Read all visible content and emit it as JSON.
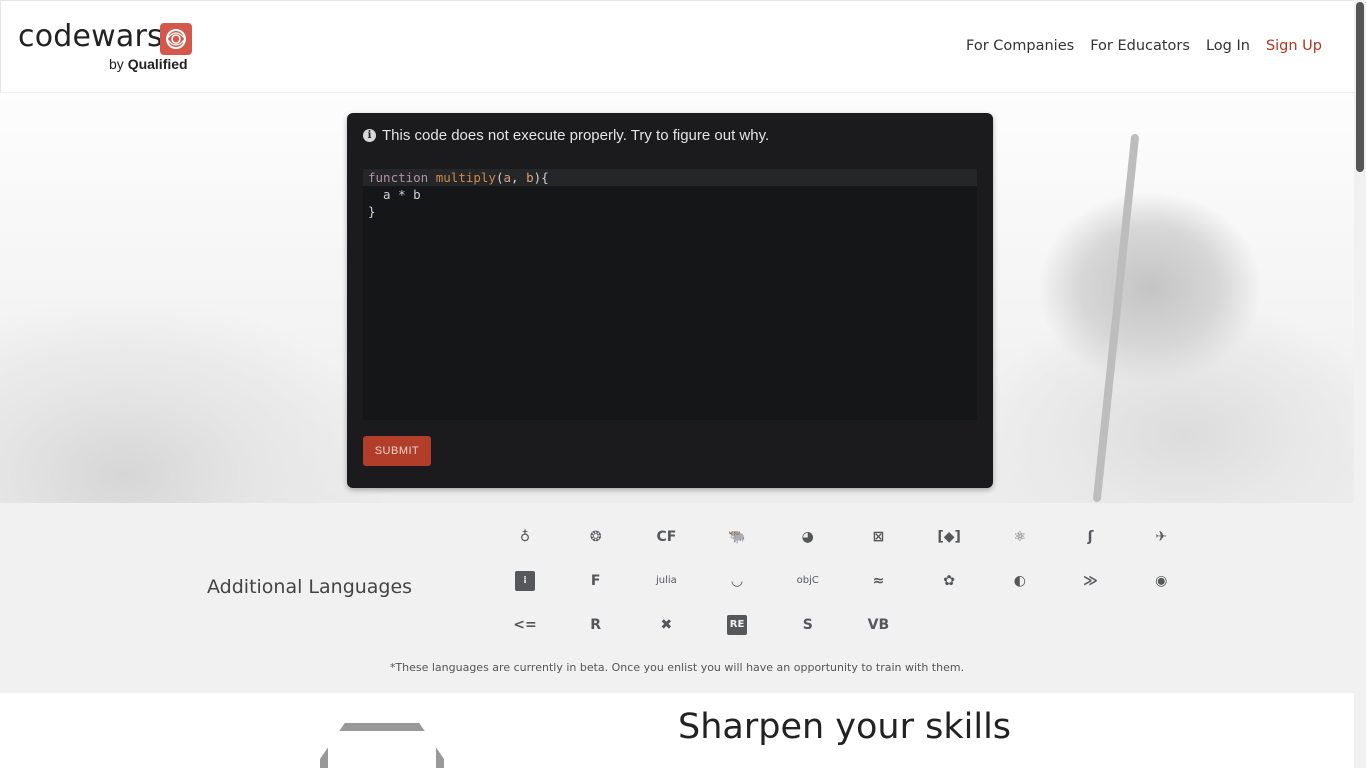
{
  "header": {
    "logo_word": "codewars",
    "logo_by": "by",
    "logo_brand": "Qualified",
    "nav": {
      "companies": "For Companies",
      "educators": "For Educators",
      "login": "Log In",
      "signup": "Sign Up"
    },
    "colors": {
      "accent": "#b1361e",
      "logo": "#d1584a"
    }
  },
  "code_card": {
    "notice": "This code does not execute properly. Try to figure out why.",
    "code_lines": [
      "function multiply(a, b){",
      "  a * b",
      "}"
    ],
    "submit_label": "SUBMIT"
  },
  "languages": {
    "title": "Additional Languages",
    "icons": [
      "agda-icon",
      "bf-icon",
      "cf-icon",
      "cobol-icon",
      "crystal-icon",
      "elm-icon",
      "erlang-icon",
      "factor-icon",
      "fortran-icon",
      "haxe-icon",
      "idris-icon",
      "forth-icon",
      "julia-icon",
      "lean-icon",
      "objc-icon",
      "ocaml-icon",
      "pascal-icon",
      "perl-icon",
      "powershell-icon",
      "prolog-icon",
      "purescript-icon",
      "r-icon",
      "raku-icon",
      "reason-icon",
      "solidity-icon",
      "vb-icon"
    ],
    "icon_labels": [
      "♁",
      "❂",
      "CF",
      "🐃",
      "◕",
      "⊠",
      "[◆]",
      "⚛",
      "ʃ",
      "✈",
      "⁞",
      "F",
      "julia",
      "◡",
      "objC",
      "≈",
      "✿",
      "◐",
      "≫",
      "◉",
      "<=",
      "R",
      "✖",
      "RE",
      "S",
      "VB"
    ],
    "beta_note": "*These languages are currently in beta. Once you enlist you will have an opportunity to train with them."
  },
  "bottom": {
    "heading": "Sharpen your skills"
  }
}
